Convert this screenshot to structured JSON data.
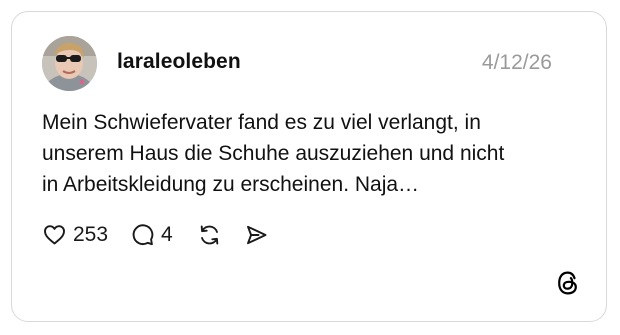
{
  "post": {
    "username": "laraleoleben",
    "date": "4/12/26",
    "text": "Mein Schwiefervater fand es zu viel verlangt, in\nunserem Haus die Schuhe auszuziehen und nicht\nin Arbeitskleidung zu erscheinen. Naja…",
    "likes": "253",
    "replies": "4"
  },
  "icons": {
    "like": "heart-icon",
    "reply": "speech-bubble-icon",
    "repost": "repost-icon",
    "share": "send-icon",
    "brand": "threads-logo"
  },
  "colors": {
    "text": "#111111",
    "muted": "#9a9a9a",
    "border": "#d9d9d9"
  }
}
